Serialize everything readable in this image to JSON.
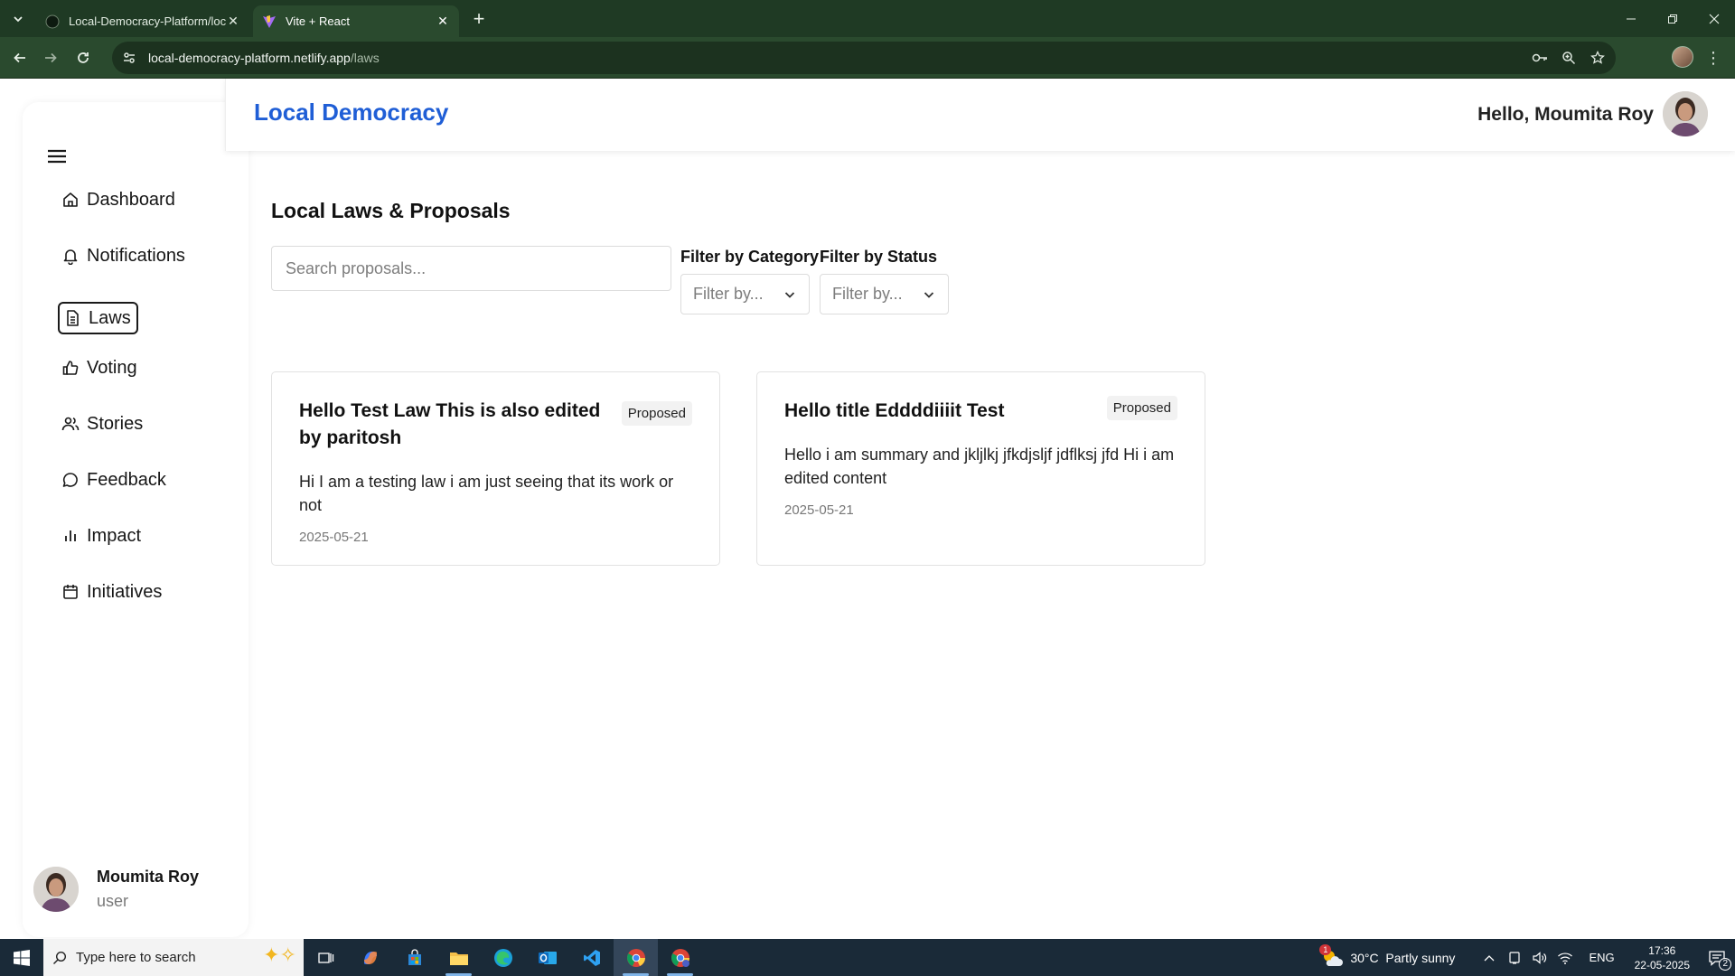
{
  "browser": {
    "tabs": [
      {
        "title": "Local-Democracy-Platform/local-democracy",
        "active": false
      },
      {
        "title": "Vite + React",
        "active": true
      }
    ],
    "url_host": "local-democracy-platform.netlify.app",
    "url_path": "/laws"
  },
  "header": {
    "brand": "Local Democracy",
    "greeting": "Hello, Moumita Roy"
  },
  "sidebar": {
    "items": [
      {
        "label": "Dashboard",
        "icon": "home-icon"
      },
      {
        "label": "Notifications",
        "icon": "bell-icon"
      },
      {
        "label": "Laws",
        "icon": "document-icon",
        "active": true
      },
      {
        "label": "Voting",
        "icon": "thumbs-up-icon"
      },
      {
        "label": "Stories",
        "icon": "users-icon"
      },
      {
        "label": "Feedback",
        "icon": "chat-bubble-icon"
      },
      {
        "label": "Impact",
        "icon": "bar-chart-icon"
      },
      {
        "label": "Initiatives",
        "icon": "calendar-icon"
      }
    ],
    "user": {
      "name": "Moumita Roy",
      "role": "user"
    }
  },
  "main": {
    "title": "Local Laws & Proposals",
    "search_placeholder": "Search proposals...",
    "filters": [
      {
        "label": "Filter by Category",
        "value": "Filter by..."
      },
      {
        "label": "Filter by Status",
        "value": "Filter by..."
      }
    ],
    "cards": [
      {
        "title": "Hello Test Law This is also edited by paritosh",
        "status": "Proposed",
        "summary": "Hi I am a testing law i am just seeing that its work or not",
        "date": "2025-05-21"
      },
      {
        "title": "Hello title Eddddiiiit Test",
        "status": "Proposed",
        "summary": "Hello i am summary and jkljlkj jfkdjsljf jdflksj jfd Hi i am edited content",
        "date": "2025-05-21"
      }
    ]
  },
  "taskbar": {
    "search_placeholder": "Type here to search",
    "weather": "30°C  Partly sunny",
    "weather_alert": "1",
    "language": "ENG",
    "time": "17:36",
    "date": "22-05-2025",
    "notification_count": "2"
  }
}
